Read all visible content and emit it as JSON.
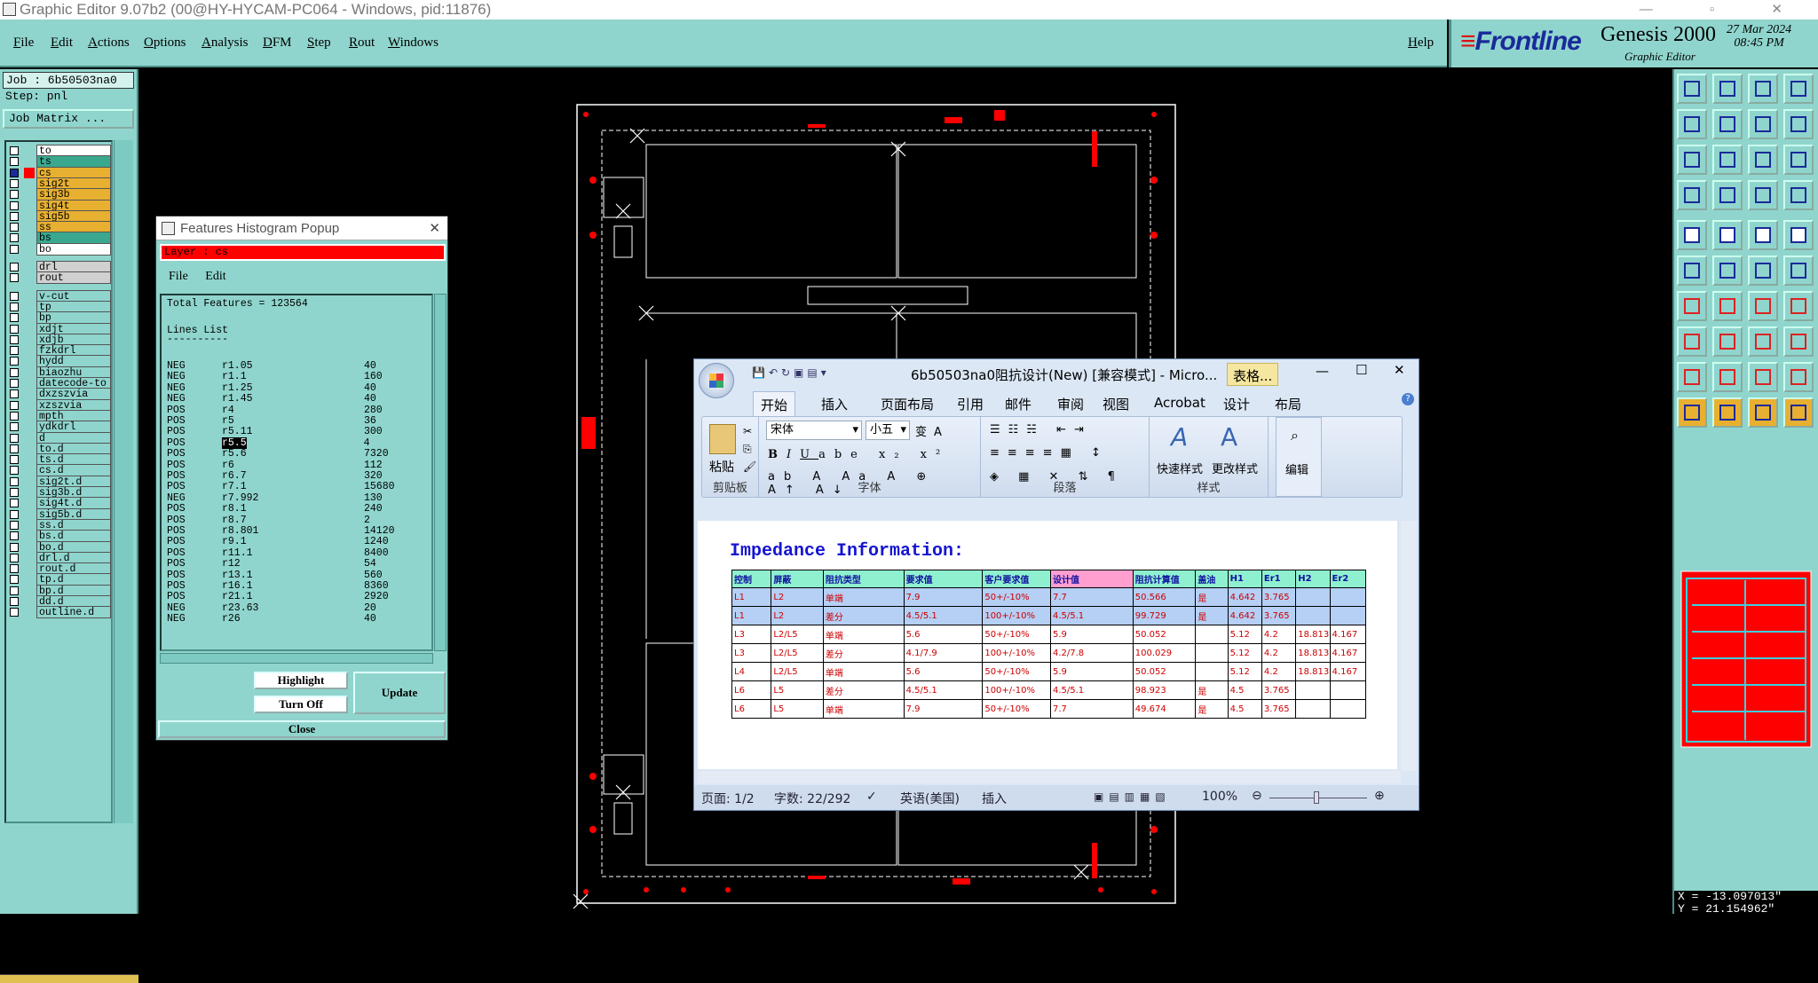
{
  "title_bar": {
    "text": "Graphic Editor 9.07b2 (00@HY-HYCAM-PC064 - Windows, pid:11876)"
  },
  "menu": [
    "File",
    "Edit",
    "Actions",
    "Options",
    "Analysis",
    "DFM",
    "Step",
    "Rout",
    "Windows"
  ],
  "help": "Help",
  "brand": {
    "logo": "Frontline",
    "product": "Genesis 2000",
    "subtitle": "Graphic Editor",
    "date": "27 Mar 2024",
    "time": "08:45 PM"
  },
  "job": {
    "job_label": "Job : 6b50503na0",
    "step_label": "Step: pnl",
    "matrix_button": "Job Matrix ..."
  },
  "layers": [
    {
      "name": "to",
      "color": "#ffffff",
      "checked": false
    },
    {
      "name": "ts",
      "color": "#3aa88f",
      "checked": false
    },
    {
      "name": "cs",
      "color": "#e8b030",
      "checked": true,
      "swatch": "#ff0000"
    },
    {
      "name": "sig2t",
      "color": "#e8b030",
      "checked": false
    },
    {
      "name": "sig3b",
      "color": "#e8b030",
      "checked": false
    },
    {
      "name": "sig4t",
      "color": "#e8b030",
      "checked": false
    },
    {
      "name": "sig5b",
      "color": "#e8b030",
      "checked": false
    },
    {
      "name": "ss",
      "color": "#e8b030",
      "checked": false
    },
    {
      "name": "bs",
      "color": "#3aa88f",
      "checked": false
    },
    {
      "name": "bo",
      "color": "#ffffff",
      "checked": false
    },
    {
      "name": "drl",
      "color": "#d0d0d0",
      "checked": false
    },
    {
      "name": "rout",
      "color": "#d0d0d0",
      "checked": false
    },
    {
      "name": "v-cut",
      "color": "#8fd5cd",
      "checked": false
    },
    {
      "name": "tp",
      "color": "#8fd5cd",
      "checked": false
    },
    {
      "name": "bp",
      "color": "#8fd5cd",
      "checked": false
    },
    {
      "name": "xdjt",
      "color": "#8fd5cd",
      "checked": false
    },
    {
      "name": "xdjb",
      "color": "#8fd5cd",
      "checked": false
    },
    {
      "name": "fzkdrl",
      "color": "#8fd5cd",
      "checked": false
    },
    {
      "name": "hydd",
      "color": "#8fd5cd",
      "checked": false
    },
    {
      "name": "biaozhu",
      "color": "#8fd5cd",
      "checked": false
    },
    {
      "name": "datecode-to",
      "color": "#8fd5cd",
      "checked": false
    },
    {
      "name": "dxzszvia",
      "color": "#8fd5cd",
      "checked": false
    },
    {
      "name": "xzszvia",
      "color": "#8fd5cd",
      "checked": false
    },
    {
      "name": "mpth",
      "color": "#8fd5cd",
      "checked": false
    },
    {
      "name": "ydkdrl",
      "color": "#8fd5cd",
      "checked": false
    },
    {
      "name": "d",
      "color": "#8fd5cd",
      "checked": false
    },
    {
      "name": "to.d",
      "color": "#8fd5cd",
      "checked": false
    },
    {
      "name": "ts.d",
      "color": "#8fd5cd",
      "checked": false
    },
    {
      "name": "cs.d",
      "color": "#8fd5cd",
      "checked": false
    },
    {
      "name": "sig2t.d",
      "color": "#8fd5cd",
      "checked": false
    },
    {
      "name": "sig3b.d",
      "color": "#8fd5cd",
      "checked": false
    },
    {
      "name": "sig4t.d",
      "color": "#8fd5cd",
      "checked": false
    },
    {
      "name": "sig5b.d",
      "color": "#8fd5cd",
      "checked": false
    },
    {
      "name": "ss.d",
      "color": "#8fd5cd",
      "checked": false
    },
    {
      "name": "bs.d",
      "color": "#8fd5cd",
      "checked": false
    },
    {
      "name": "bo.d",
      "color": "#8fd5cd",
      "checked": false
    },
    {
      "name": "drl.d",
      "color": "#8fd5cd",
      "checked": false
    },
    {
      "name": "rout.d",
      "color": "#8fd5cd",
      "checked": false
    },
    {
      "name": "tp.d",
      "color": "#8fd5cd",
      "checked": false
    },
    {
      "name": "bp.d",
      "color": "#8fd5cd",
      "checked": false
    },
    {
      "name": "dd.d",
      "color": "#8fd5cd",
      "checked": false
    },
    {
      "name": "outline.d",
      "color": "#8fd5cd",
      "checked": false
    }
  ],
  "features_popup": {
    "title": "Features Histogram Popup",
    "layer": "Layer :  cs",
    "menu": [
      "File",
      "Edit"
    ],
    "total": "Total Features = 123564",
    "list_title": "Lines List",
    "list_rule": "----------",
    "rows": [
      [
        "NEG",
        "r1.05",
        "40"
      ],
      [
        "NEG",
        "r1.1",
        "160"
      ],
      [
        "NEG",
        "r1.25",
        "40"
      ],
      [
        "NEG",
        "r1.45",
        "40"
      ],
      [
        "POS",
        "r4",
        "280"
      ],
      [
        "POS",
        "r5",
        "36"
      ],
      [
        "POS",
        "r5.11",
        "300"
      ],
      [
        "POS",
        "r5.5",
        "4"
      ],
      [
        "POS",
        "r5.6",
        "7320"
      ],
      [
        "POS",
        "r6",
        "112"
      ],
      [
        "POS",
        "r6.7",
        "320"
      ],
      [
        "POS",
        "r7.1",
        "15680"
      ],
      [
        "NEG",
        "r7.992",
        "130"
      ],
      [
        "POS",
        "r8.1",
        "240"
      ],
      [
        "POS",
        "r8.7",
        "2"
      ],
      [
        "POS",
        "r8.801",
        "14120"
      ],
      [
        "POS",
        "r9.1",
        "1240"
      ],
      [
        "POS",
        "r11.1",
        "8400"
      ],
      [
        "POS",
        "r12",
        "54"
      ],
      [
        "POS",
        "r13.1",
        "560"
      ],
      [
        "POS",
        "r16.1",
        "8360"
      ],
      [
        "POS",
        "r21.1",
        "2920"
      ],
      [
        "NEG",
        "r23.63",
        "20"
      ],
      [
        "NEG",
        "r26",
        "40"
      ]
    ],
    "highlighted_symbol": "r5.5",
    "buttons": {
      "highlight": "Highlight",
      "turn_off": "Turn Off",
      "update": "Update",
      "close": "Close"
    }
  },
  "word": {
    "title": "6b50503na0阻抗设计(New) [兼容模式] - Micro...",
    "context_tab": "表格...",
    "tabs": [
      "开始",
      "插入",
      "页面布局",
      "引用",
      "邮件",
      "审阅",
      "视图",
      "Acrobat",
      "设计",
      "布局"
    ],
    "font_name": "宋体",
    "font_size": "小五",
    "groups": {
      "clipboard": "剪贴板",
      "font": "字体",
      "paragraph": "段落",
      "styles": "样式"
    },
    "paste": "粘贴",
    "quick_styles": "快速样式",
    "change_styles": "更改样式",
    "edit": "编辑",
    "doc_heading": "Impedance Information:",
    "table_headers": [
      "控制",
      "屏蔽",
      "阻抗类型",
      "要求值",
      "客户要求值",
      "设计值",
      "阻抗计算值",
      "盖油",
      "H1",
      "Er1",
      "H2",
      "Er2"
    ],
    "table_rows": [
      [
        "L1",
        "L2",
        "单端",
        "7.9",
        "50+/-10%",
        "7.7",
        "50.566",
        "是",
        "4.642",
        "3.765",
        "",
        ""
      ],
      [
        "L1",
        "L2",
        "差分",
        "4.5/5.1",
        "100+/-10%",
        "4.5/5.1",
        "99.729",
        "是",
        "4.642",
        "3.765",
        "",
        ""
      ],
      [
        "L3",
        "L2/L5",
        "单端",
        "5.6",
        "50+/-10%",
        "5.9",
        "50.052",
        "",
        "5.12",
        "4.2",
        "18.813",
        "4.167"
      ],
      [
        "L3",
        "L2/L5",
        "差分",
        "4.1/7.9",
        "100+/-10%",
        "4.2/7.8",
        "100.029",
        "",
        "5.12",
        "4.2",
        "18.813",
        "4.167"
      ],
      [
        "L4",
        "L2/L5",
        "单端",
        "5.6",
        "50+/-10%",
        "5.9",
        "50.052",
        "",
        "5.12",
        "4.2",
        "18.813",
        "4.167"
      ],
      [
        "L6",
        "L5",
        "差分",
        "4.5/5.1",
        "100+/-10%",
        "4.5/5.1",
        "98.923",
        "是",
        "4.5",
        "3.765",
        "",
        ""
      ],
      [
        "L6",
        "L5",
        "单端",
        "7.9",
        "50+/-10%",
        "7.7",
        "49.674",
        "是",
        "4.5",
        "3.765",
        "",
        ""
      ]
    ],
    "status": {
      "page": "页面: 1/2",
      "words": "字数: 22/292",
      "language": "英语(美国)",
      "mode": "插入",
      "zoom": "100%"
    }
  },
  "coords": {
    "x": "X = -13.097013\"",
    "y": "Y = 21.154962\""
  },
  "colors": {
    "panel": "#8fd5cd",
    "accent_red": "#ff0000",
    "orange": "#e8b030",
    "navy": "#1a2a9a"
  }
}
